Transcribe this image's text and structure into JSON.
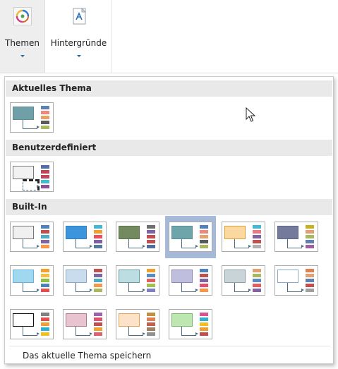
{
  "ribbon": {
    "themes_label": "Themen",
    "backgrounds_label": "Hintergründe"
  },
  "panel": {
    "current_theme_header": "Aktuelles Thema",
    "custom_header": "Benutzerdefiniert",
    "builtin_header": "Built-In",
    "save_current_theme": "Das aktuelle Thema speichern"
  },
  "themes": {
    "current": {
      "fill": "#6fa0a8",
      "stroke": "#5e8c94",
      "dash": false,
      "swatches": [
        "#5b82b5",
        "#e98a7d",
        "#e5a26a",
        "#5a5a5a",
        "#a8b860"
      ]
    },
    "custom": [
      {
        "fill": "#f2f2f2",
        "stroke": "#7a7a7a",
        "dash": true,
        "swatches": [
          "#4f6fa8",
          "#c0455b",
          "#c0455b",
          "#3fbcd0",
          "#8c4c9c"
        ]
      }
    ],
    "builtin": [
      {
        "fill": "#f0f0f0",
        "stroke": "#777777",
        "dash": false,
        "swatches": [
          "#4f81bd",
          "#c0504d",
          "#4bacc6",
          "#8064a2",
          "#f79646"
        ]
      },
      {
        "fill": "#3b94dc",
        "stroke": "#2f7fc0",
        "dash": false,
        "swatches": [
          "#41b8d5",
          "#f0a030",
          "#e9505f",
          "#7f5fa8",
          "#55799f"
        ]
      },
      {
        "fill": "#738a5e",
        "stroke": "#5c7049",
        "dash": false,
        "swatches": [
          "#6e6e6e",
          "#8064a2",
          "#c0504d",
          "#c0504d",
          "#4f6f9a"
        ]
      },
      {
        "fill": "#6ea5ab",
        "stroke": "#5a8c92",
        "dash": false,
        "swatches": [
          "#4f81bd",
          "#e98a7d",
          "#e5a26a",
          "#5a5a5a",
          "#a8b860"
        ],
        "selected": true
      },
      {
        "fill": "#fad8a0",
        "stroke": "#d9a040",
        "dash": false,
        "swatches": [
          "#41b8d5",
          "#e97a8a",
          "#8064a2",
          "#c0504d",
          "#b0b0b0"
        ]
      },
      {
        "fill": "#747a9a",
        "stroke": "#5e6486",
        "dash": false,
        "swatches": [
          "#c8b020",
          "#e0a070",
          "#a8b860",
          "#6080b0",
          "#a060a0"
        ]
      },
      {
        "fill": "#a0d8f0",
        "stroke": "#6ab0d8",
        "dash": false,
        "swatches": [
          "#f0a030",
          "#f0c040",
          "#8cc040",
          "#4f81bd",
          "#e05050"
        ]
      },
      {
        "fill": "#c9dced",
        "stroke": "#8aa6c8",
        "dash": false,
        "swatches": [
          "#c0504d",
          "#8064a2",
          "#4bacc6",
          "#f79646",
          "#a8b860"
        ]
      },
      {
        "fill": "#bcdde2",
        "stroke": "#6c9aa2",
        "dash": false,
        "swatches": [
          "#f0a030",
          "#5a8cc0",
          "#e06060",
          "#a0c050",
          "#8080c0"
        ]
      },
      {
        "fill": "#c0bedf",
        "stroke": "#8a88b8",
        "dash": false,
        "swatches": [
          "#4f81bd",
          "#c0504d",
          "#8064a2",
          "#e05070",
          "#f79646"
        ]
      },
      {
        "fill": "#c8d4d8",
        "stroke": "#8ca0a8",
        "dash": false,
        "swatches": [
          "#e0a070",
          "#a8b860",
          "#5a8cc0",
          "#e06060",
          "#8064a2"
        ]
      },
      {
        "fill": "#ffffff",
        "stroke": "#8aa6c8",
        "dash": false,
        "swatches": [
          "#e08050",
          "#e0a070",
          "#6080b0",
          "#c05050",
          "#a0a0a0"
        ]
      },
      {
        "fill": "#ffffff",
        "stroke": "#111111",
        "dash": false,
        "swatches": [
          "#808080",
          "#e05050",
          "#f0a030",
          "#30b0d0",
          "#f0c020"
        ]
      },
      {
        "fill": "#e8c4d0",
        "stroke": "#b07890",
        "dash": false,
        "swatches": [
          "#a060b0",
          "#e05070",
          "#c05050",
          "#f0a030",
          "#e06070"
        ]
      },
      {
        "fill": "#fbe2c8",
        "stroke": "#e0a060",
        "dash": false,
        "swatches": [
          "#c09040",
          "#e08050",
          "#c06050",
          "#a08060",
          "#909090"
        ]
      },
      {
        "fill": "#bde6b0",
        "stroke": "#7bb86c",
        "dash": false,
        "swatches": [
          "#e05090",
          "#30b0d0",
          "#f0c020",
          "#f0a030",
          "#c0504d"
        ]
      }
    ]
  }
}
